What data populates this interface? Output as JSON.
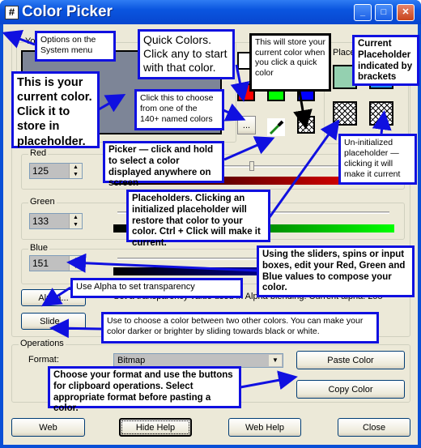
{
  "window": {
    "title": "Color Picker",
    "icon": "#"
  },
  "your_color": {
    "label": "Your Color",
    "color": "#7d8597"
  },
  "quick_colors": {
    "colors": [
      "#ffffff",
      "#ff0000",
      "#00ff00",
      "#0000ff"
    ],
    "named_button": "..."
  },
  "placeholders": {
    "label": "Placeholders",
    "colors": [
      "#94d0b0",
      "#1e90ff"
    ]
  },
  "red": {
    "label": "Red",
    "value": "125"
  },
  "green": {
    "label": "Green",
    "value": "133"
  },
  "blue": {
    "label": "Blue",
    "value": "151"
  },
  "alpha": {
    "button": "Alpha...",
    "text": "Set a transparency value used in Alpha blending.  Current alpha: 255"
  },
  "slide": {
    "button": "Slide..."
  },
  "operations": {
    "label": "Operations",
    "format_label": "Format:",
    "format_value": "Bitmap",
    "paste": "Paste Color",
    "copy": "Copy Color"
  },
  "footer": {
    "web": "Web",
    "hide_help": "Hide Help",
    "web_help": "Web Help",
    "close": "Close"
  },
  "help": {
    "system_menu": "Options on the System menu",
    "quick_colors": "Quick Colors. Click any to start with that color.",
    "current_color": "This is your current color. Click it to store in placeholder.",
    "named_colors": "Click this to choose from one of the 140+ named colors",
    "picker": "Picker — click and hold to select a color displayed anywhere on screen",
    "store": "This will store your current color when you click a quick color",
    "current_placeholder": "Current Placeholder indicated by brackets",
    "uninit": "Un-initialized placeholder — clicking it will make it current",
    "placeholders": "Placeholders.  Clicking an initialized placeholder will restore that color to your color. Ctrl + Click will make it current.",
    "sliders": "Using the sliders, spins or input boxes, edit your Red, Green and Blue values to compose your color.",
    "alpha": "Use Alpha to set transparency",
    "slide": "Use to choose a color between two other colors.   You can make your color darker or brighter by sliding towards black or white.",
    "format": "Choose your format and use the buttons for clipboard operations.  Select appropriate format before pasting a color."
  }
}
